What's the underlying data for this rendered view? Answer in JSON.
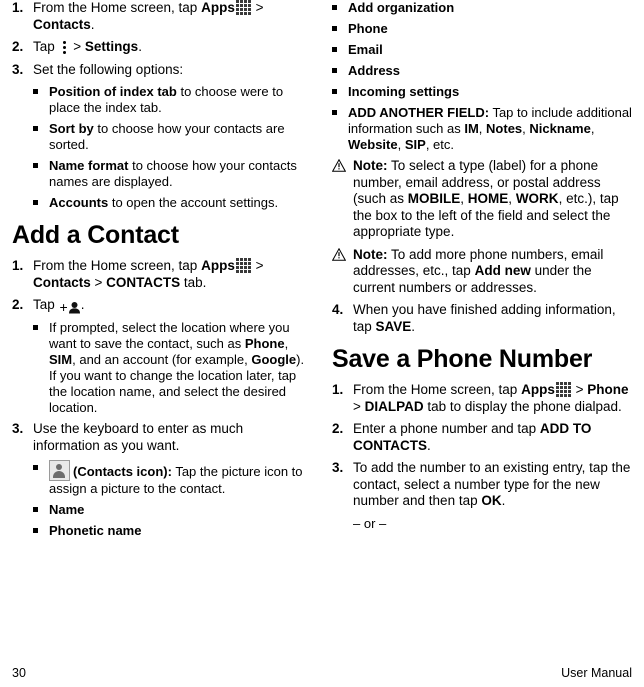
{
  "document": {
    "footer": {
      "page_number": "30",
      "manual_label": "User Manual"
    }
  },
  "left_column": {
    "steps": [
      {
        "num": "1.",
        "text_before": "From the Home screen, tap ",
        "bold_1": "Apps",
        "icon": "apps-grid-icon",
        "sep": " > ",
        "bold_2": "Contacts",
        "text_after": "."
      },
      {
        "num": "2.",
        "text_before": "Tap ",
        "icon": "kebab-menu-icon",
        "sep": " > ",
        "bold_1": "Settings",
        "text_after": "."
      },
      {
        "num": "3.",
        "text_before": "Set the following options:"
      }
    ],
    "option_bullets": [
      {
        "bold": "Position of index tab",
        "rest": " to choose were to place the index tab."
      },
      {
        "bold": "Sort by",
        "rest": " to choose how your contacts are sorted."
      },
      {
        "bold": "Name format",
        "rest": " to choose how your contacts names are displayed."
      },
      {
        "bold": "Accounts",
        "rest": " to open the account settings."
      }
    ],
    "heading": "Add a Contact",
    "add_steps": [
      {
        "num": "1.",
        "text_before": "From the Home screen, tap ",
        "bold_1": "Apps",
        "icon": "apps-grid-icon",
        "mid": " > ",
        "bold_2": "Contacts",
        "mid2": " > ",
        "bold_3": "CONTACTS",
        "text_after": " tab."
      },
      {
        "num": "2.",
        "text_before": "Tap ",
        "icon": "add-contact-icon",
        "text_after": "."
      }
    ],
    "prompt_bullet": "If prompted, select the location where you want to save the contact, such as ",
    "prompt_bold_1": "Phone",
    "prompt_mid_1": ", ",
    "prompt_bold_2": "SIM",
    "prompt_mid_2": ", and an account (for example, ",
    "prompt_bold_3": "Google",
    "prompt_rest": "). If you want to change the location later, tap the location name, and select the desired location.",
    "step3": {
      "num": "3.",
      "text": "Use the keyboard to enter as much information as you want."
    },
    "field_bullets": [
      {
        "icon": "contacts-picture-icon",
        "bold": "(Contacts icon):",
        "rest": " Tap the picture icon to assign a picture to the contact."
      },
      {
        "bold": "Name",
        "rest": ""
      },
      {
        "bold": "Phonetic name",
        "rest": ""
      }
    ]
  },
  "right_column": {
    "field_bullets": [
      {
        "bold": "Add organization",
        "rest": ""
      },
      {
        "bold": "Phone",
        "rest": ""
      },
      {
        "bold": "Email",
        "rest": ""
      },
      {
        "bold": "Address",
        "rest": ""
      },
      {
        "bold": "Incoming settings",
        "rest": ""
      }
    ],
    "add_field_bullet": {
      "bold": "ADD ANOTHER FIELD:",
      "rest_1": " Tap to include additional information such as ",
      "b1": "IM",
      "s1": ", ",
      "b2": "Notes",
      "s2": ", ",
      "b3": "Nickname",
      "s3": ", ",
      "b4": "Website",
      "s4": ", ",
      "b5": "SIP",
      "rest_2": ", etc."
    },
    "note_1": {
      "icon": "warning-triangle-icon",
      "bold": "Note:",
      "t1": " To select a type (label) for a phone number, email address, or postal address (such as ",
      "b1": "MOBILE",
      "s1": ", ",
      "b2": "HOME",
      "s2": ", ",
      "b3": "WORK",
      "t2": ", etc.), tap the box to the left of the field and select the appropriate type."
    },
    "note_2": {
      "icon": "warning-triangle-icon",
      "bold": "Note:",
      "t1": " To add more phone numbers, email addresses, etc., tap ",
      "b1": "Add new",
      "t2": " under the current numbers or addresses."
    },
    "step4": {
      "num": "4.",
      "t1": "When you have finished adding information, tap ",
      "b1": "SAVE",
      "t2": "."
    },
    "heading": "Save a Phone Number",
    "save_steps": [
      {
        "num": "1.",
        "t1": "From the Home screen, tap ",
        "b1": "Apps",
        "icon": "apps-grid-icon",
        "s1": " > ",
        "b2": "Phone",
        "s2": " > ",
        "b3": "DIALPAD",
        "t2": " tab to display the phone dialpad."
      },
      {
        "num": "2.",
        "t1": "Enter a phone number and tap ",
        "b1": "ADD TO CONTACTS",
        "t2": "."
      },
      {
        "num": "3.",
        "t1": "To add the number to an existing entry, tap the contact, select a number type for the new number and then tap ",
        "b1": "OK",
        "t2": "."
      }
    ],
    "or_line": "– or –"
  }
}
